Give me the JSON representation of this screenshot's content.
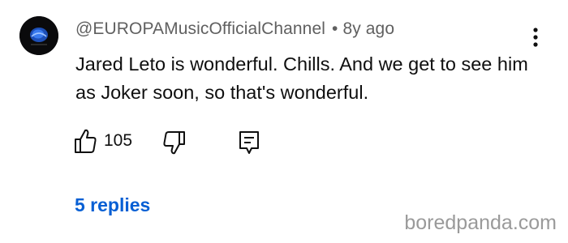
{
  "comment": {
    "author": "@EUROPAMusicOfficialChannel",
    "separator": "•",
    "time": "8y ago",
    "text": "Jared Leto is wonderful. Chills. And we get to see him as Joker soon, so that's wonderful.",
    "like_count": "105",
    "replies_label": "5 replies"
  },
  "watermark": "boredpanda.com",
  "icons": {
    "like": "thumbs-up-icon",
    "dislike": "thumbs-down-icon",
    "reply": "comment-icon",
    "menu": "more-vertical-icon"
  },
  "colors": {
    "link": "#065fd4",
    "meta": "#606060",
    "text": "#0f0f0f",
    "watermark": "#9a9a9a"
  }
}
